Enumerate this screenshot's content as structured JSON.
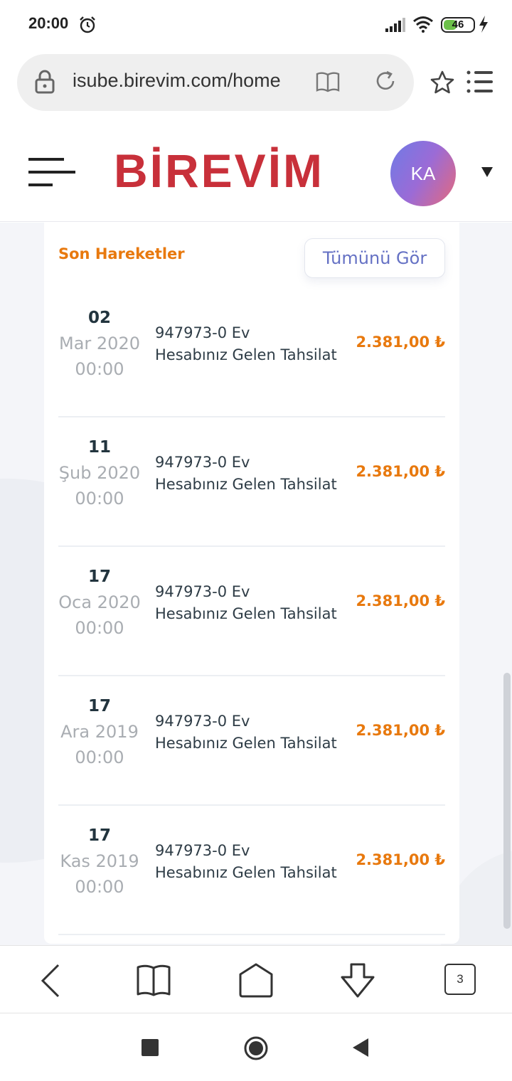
{
  "status_bar": {
    "time": "20:00",
    "battery": "46",
    "battery_level": 0.46
  },
  "browser": {
    "url": "isube.birevim.com/home",
    "tabs_count": "3"
  },
  "header": {
    "logo": "BİREVİM",
    "avatar_initials": "KA"
  },
  "card": {
    "title": "Son Hareketler",
    "see_all_label": "Tümünü Gör",
    "transactions": [
      {
        "day": "02",
        "month_year": "Mar 2020",
        "time": "00:00",
        "line1": "947973-0 Ev",
        "line2": "Hesabınız Gelen Tahsilat",
        "amount": "2.381,00 ₺"
      },
      {
        "day": "11",
        "month_year": "Şub 2020",
        "time": "00:00",
        "line1": "947973-0 Ev",
        "line2": "Hesabınız Gelen Tahsilat",
        "amount": "2.381,00 ₺"
      },
      {
        "day": "17",
        "month_year": "Oca 2020",
        "time": "00:00",
        "line1": "947973-0 Ev",
        "line2": "Hesabınız Gelen Tahsilat",
        "amount": "2.381,00 ₺"
      },
      {
        "day": "17",
        "month_year": "Ara 2019",
        "time": "00:00",
        "line1": "947973-0 Ev",
        "line2": "Hesabınız Gelen Tahsilat",
        "amount": "2.381,00 ₺"
      },
      {
        "day": "17",
        "month_year": "Kas 2019",
        "time": "00:00",
        "line1": "947973-0 Ev",
        "line2": "Hesabınız Gelen Tahsilat",
        "amount": "2.381,00 ₺"
      }
    ]
  },
  "colors": {
    "brand": "#c8303a",
    "accent": "#e8790e",
    "button_text": "#6571c4"
  }
}
